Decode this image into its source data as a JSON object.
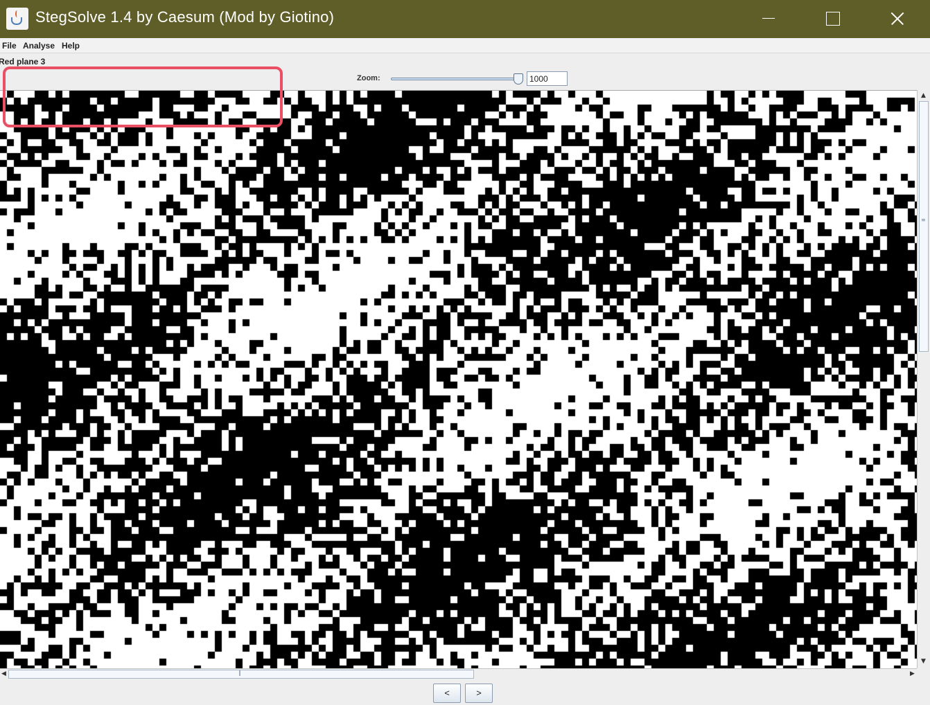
{
  "window": {
    "title": "StegSolve 1.4 by Caesum (Mod by Giotino)"
  },
  "menu": [
    {
      "label": "File"
    },
    {
      "label": "Analyse"
    },
    {
      "label": "Help"
    }
  ],
  "panel": {
    "label": "Red plane 3"
  },
  "zoom": {
    "label": "Zoom:",
    "value": "1000",
    "slider_fraction": 0.98
  },
  "navigation": {
    "prev_label": "<",
    "next_label": ">"
  },
  "highlight_color": "#ea4f66",
  "icons": [
    "java-app-icon",
    "minimize-icon",
    "maximize-icon",
    "close-icon"
  ]
}
